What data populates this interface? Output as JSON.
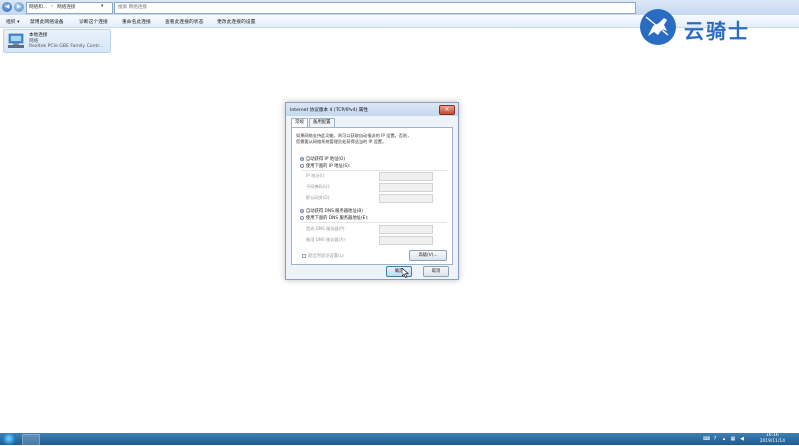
{
  "window": {
    "breadcrumb": [
      "网络和...",
      "网络连接"
    ],
    "search_placeholder": "搜索 网络连接"
  },
  "menubar": {
    "items": [
      "组织 ▾",
      "禁用此网络设备",
      "诊断这个连接",
      "重命名此连接",
      "查看此连接的状态",
      "更改此连接的设置"
    ]
  },
  "adapter": {
    "name": "本地连接",
    "network": "网络",
    "device": "Realtek PCIe GBE Family Contr..."
  },
  "logo": {
    "text": "云骑士"
  },
  "dialog": {
    "title": "Internet 协议版本 4 (TCP/IPv4) 属性",
    "close_label": "✕",
    "tabs": [
      "常规",
      "备用配置"
    ],
    "description": [
      "如果网络支持此功能，则可以获取自动指派的 IP 设置。否则，",
      "您需要从网络系统管理员处获得适当的 IP 设置。"
    ],
    "ip_auto": "自动获得 IP 地址(O)",
    "ip_manual": "使用下面的 IP 地址(S):",
    "ip_fields": [
      "IP 地址(I):",
      "子网掩码(U):",
      "默认网关(D):"
    ],
    "dns_auto": "自动获得 DNS 服务器地址(B)",
    "dns_manual": "使用下面的 DNS 服务器地址(E):",
    "dns_fields": [
      "首选 DNS 服务器(P):",
      "备用 DNS 服务器(A):"
    ],
    "validate_label": "退出时验证设置(L)",
    "advanced_label": "高级(V)...",
    "ok_label": "确定",
    "cancel_label": "取消"
  },
  "taskbar": {
    "time": "16:16",
    "date": "2019/11/14"
  }
}
